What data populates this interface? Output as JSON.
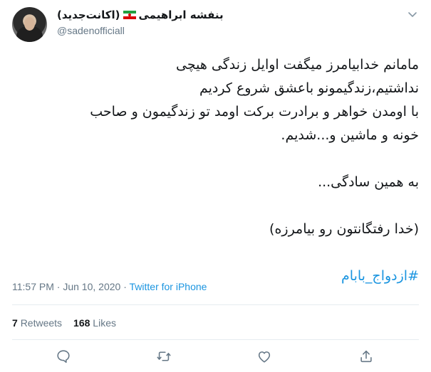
{
  "author": {
    "display_name": "بنفشه ابراهیمی",
    "display_suffix": "(اکانت‌جدید)",
    "handle": "@sadenofficiall",
    "flag_icon": "iran-flag-icon"
  },
  "tweet": {
    "line1": "مامانم خدابیامرز میگفت اوایل زندگی هیچی",
    "line2": "نداشتیم،زندگیمونو باعشق شروع کردیم",
    "line3": "با اومدن خواهر و برادرت برکت اومد تو زندگیمون و صاحب",
    "line4": "خونه و ماشین و...شدیم.",
    "line5": "به همین سادگی...",
    "line6": "(خدا رفتگانتون رو بیامرزه)",
    "hashtag": "#ازدواج_بابام"
  },
  "meta": {
    "time": "11:57 PM",
    "separator1": " · ",
    "date": "Jun 10, 2020",
    "separator2": " · ",
    "source": "Twitter for iPhone"
  },
  "stats": {
    "retweets_count": "7",
    "retweets_label": "Retweets",
    "likes_count": "168",
    "likes_label": "Likes"
  },
  "colors": {
    "link": "#1b95e0",
    "muted": "#657786",
    "text": "#14171a",
    "divider": "#e6ecf0"
  }
}
